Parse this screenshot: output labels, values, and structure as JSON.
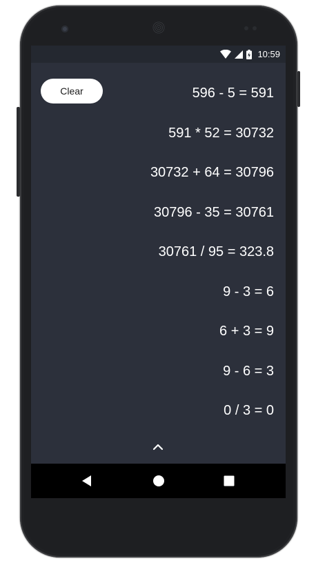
{
  "status_bar": {
    "time": "10:59",
    "icons": [
      "wifi-icon",
      "signal-icon",
      "battery-charging-icon"
    ]
  },
  "toolbar": {
    "clear_label": "Clear"
  },
  "history": {
    "entries": [
      "596 - 5 = 591",
      "591 * 52 = 30732",
      "30732 + 64 = 30796",
      "30796 - 35 = 30761",
      "30761 / 95 = 323.8",
      "9 - 3 = 6",
      "6 + 3 = 9",
      "9 - 6 = 3",
      "0 / 3 = 0"
    ]
  },
  "panel": {
    "expand_icon": "chevron-up-icon"
  },
  "nav_bar": {
    "buttons": [
      "back-icon",
      "home-icon",
      "recents-icon"
    ]
  },
  "colors": {
    "screen_background": "#2c303b",
    "status_bar_background": "#242830",
    "text": "#ffffff",
    "button_background": "#ffffff",
    "nav_bar_background": "#000000"
  }
}
